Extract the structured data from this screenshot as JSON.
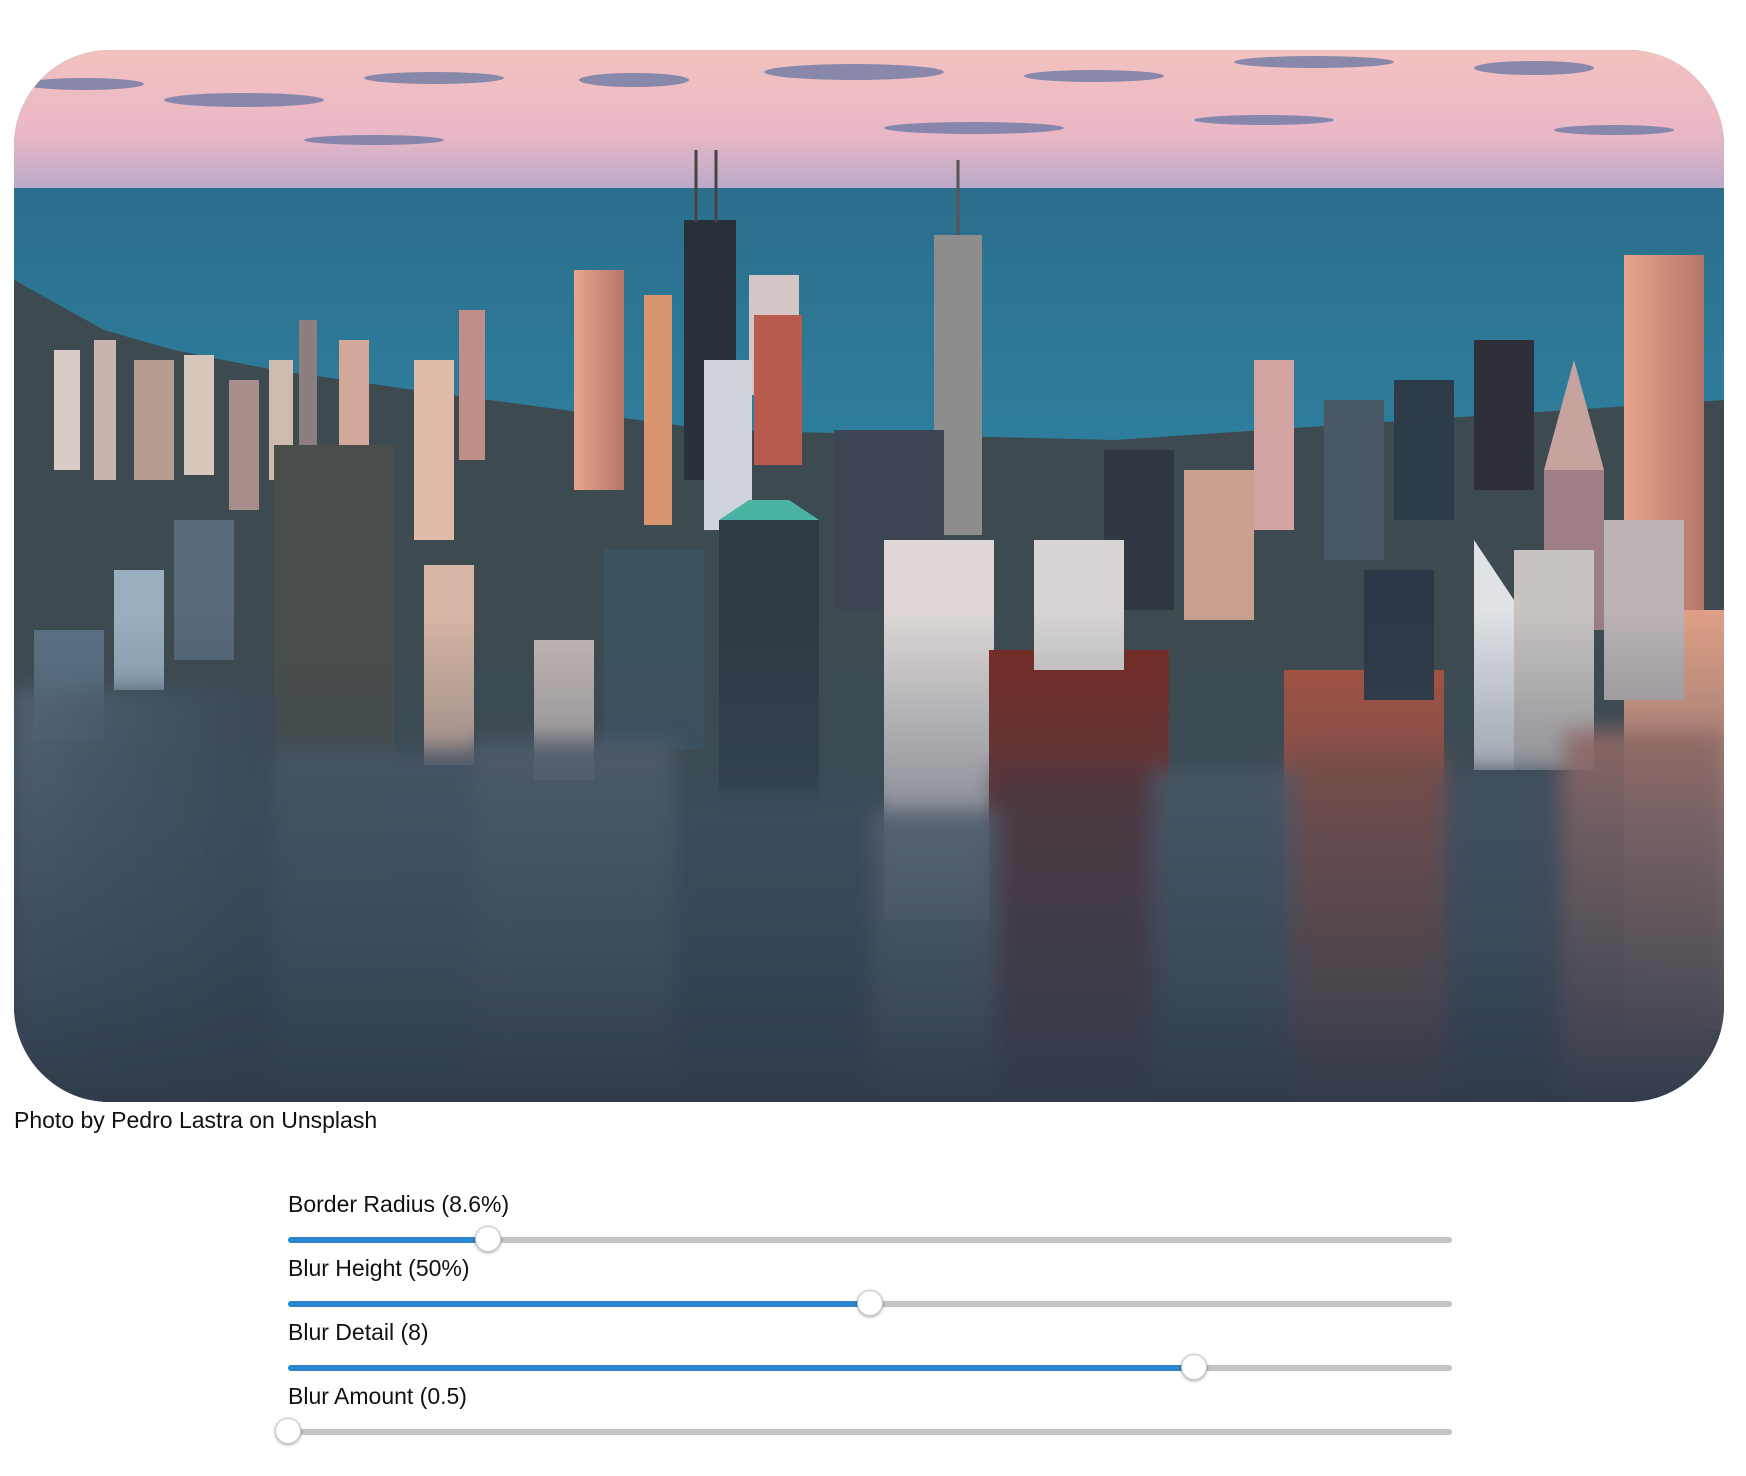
{
  "photo": {
    "description_icon": "city-skyline-photo"
  },
  "caption": "Photo by Pedro Lastra on Unsplash",
  "controls": [
    {
      "label": "Border Radius (8.6%)",
      "value": 0.172
    },
    {
      "label": "Blur Height (50%)",
      "value": 0.5
    },
    {
      "label": "Blur Detail (8)",
      "value": 0.778
    },
    {
      "label": "Blur Amount (0.5)",
      "value": 0.0
    }
  ],
  "colors": {
    "accent": "#2e86d0",
    "track": "#c4c4c4"
  }
}
